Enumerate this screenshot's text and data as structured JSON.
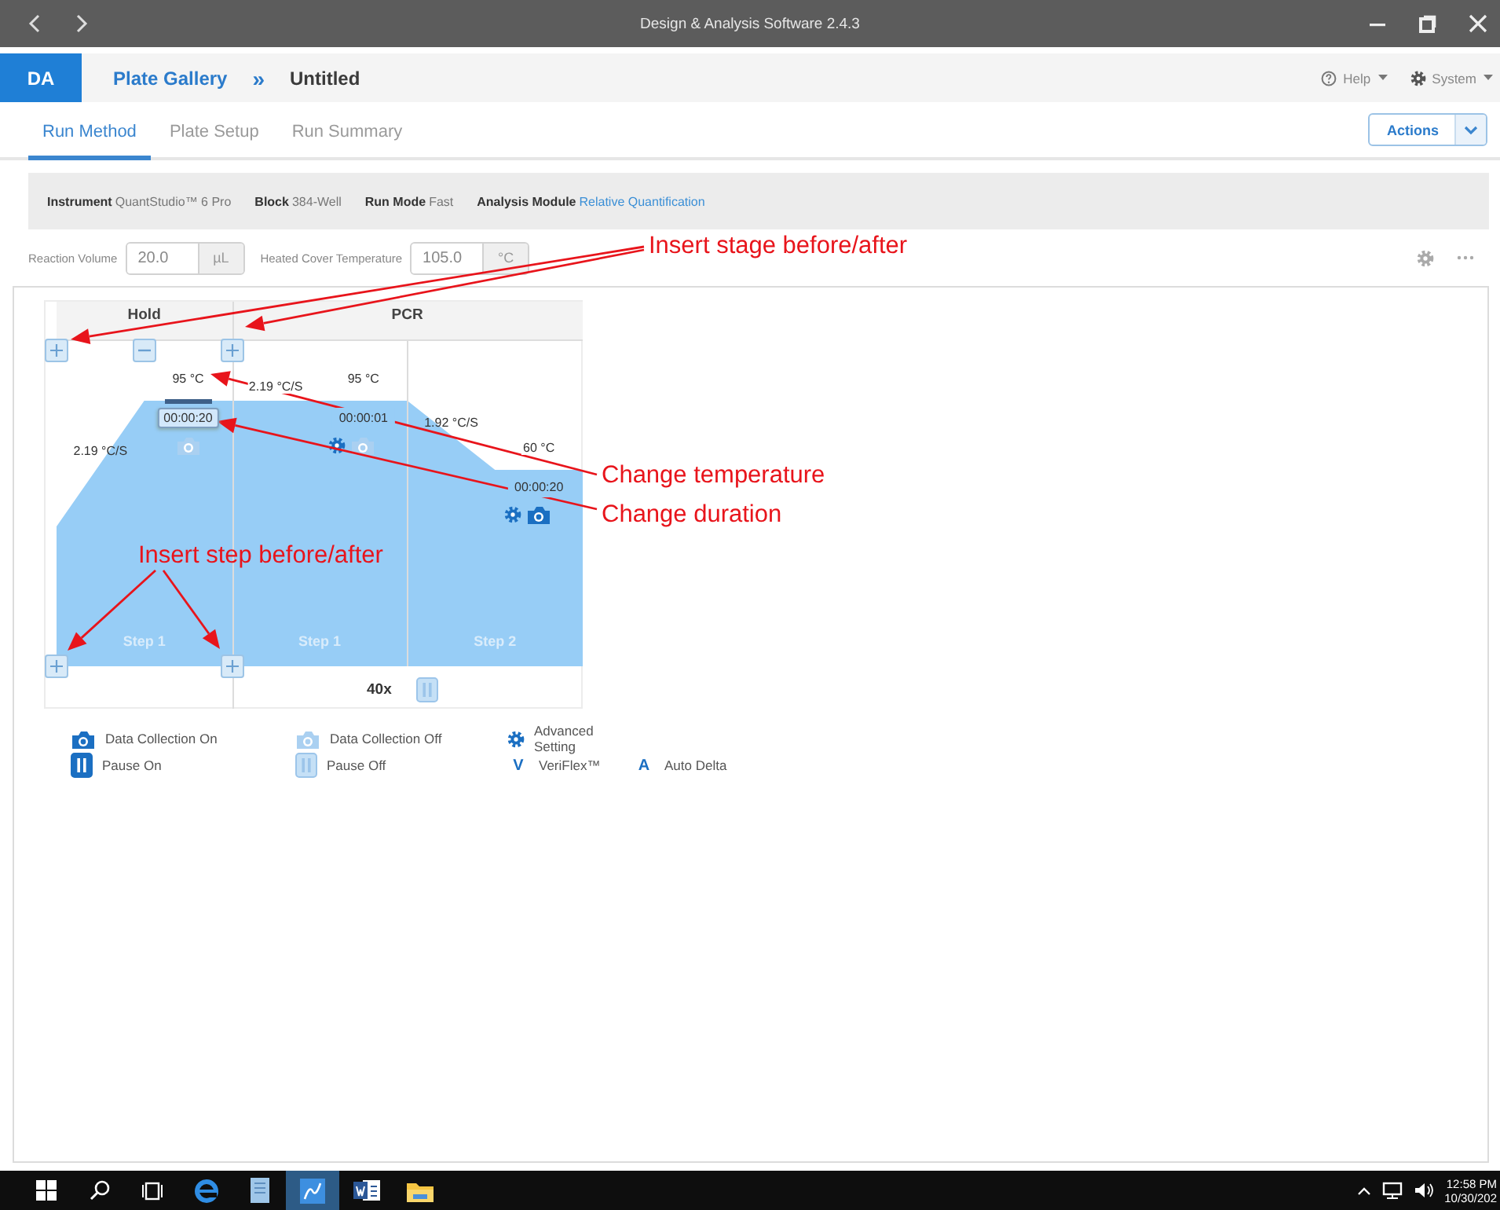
{
  "window": {
    "title": "Design & Analysis Software 2.4.3"
  },
  "header": {
    "logo": "DA",
    "breadcrumb": [
      {
        "label": "Plate Gallery",
        "kind": "link"
      },
      {
        "label": "Untitled",
        "kind": "current"
      }
    ],
    "separator": "»",
    "menus": [
      {
        "label": "Help",
        "kind": "help"
      },
      {
        "label": "System",
        "kind": "system"
      }
    ]
  },
  "tabs": [
    {
      "label": "Run Method",
      "selected": true
    },
    {
      "label": "Plate Setup",
      "selected": false
    },
    {
      "label": "Run Summary",
      "selected": false
    }
  ],
  "actions": {
    "label": "Actions"
  },
  "run_info": [
    {
      "label": "Instrument",
      "value": "QuantStudio™ 6 Pro",
      "kind": "plain"
    },
    {
      "label": "Block",
      "value": "384-Well",
      "kind": "plain"
    },
    {
      "label": "Run Mode",
      "value": "Fast",
      "kind": "plain"
    },
    {
      "label": "Analysis Module",
      "value": "Relative Quantification",
      "kind": "link"
    }
  ],
  "settings": [
    {
      "label": "Reaction Volume",
      "value": "20.0",
      "unit": "µL"
    },
    {
      "label": "Heated Cover Temperature",
      "value": "105.0",
      "unit": "°C"
    }
  ],
  "stages": [
    {
      "name": "Hold",
      "steps": [
        {
          "label": "Step 1",
          "temperature": "95 °C",
          "duration": "00:00:20",
          "ramp": "2.19 °C/S",
          "selected": true,
          "data_collection": false,
          "advanced": false
        }
      ]
    },
    {
      "name": "PCR",
      "cycles": "40x",
      "pause": false,
      "steps": [
        {
          "label": "Step 1",
          "temperature": "95 °C",
          "duration": "00:00:01",
          "ramp": "2.19 °C/S",
          "selected": false,
          "data_collection": false,
          "advanced": true
        },
        {
          "label": "Step 2",
          "temperature": "60 °C",
          "duration": "00:00:20",
          "ramp": "1.92 °C/S",
          "selected": false,
          "data_collection": true,
          "advanced": true
        }
      ]
    }
  ],
  "legend": {
    "rows": [
      {
        "items": [
          {
            "kind": "camera_on",
            "label": "Data Collection On"
          },
          {
            "kind": "camera_off",
            "label": "Data Collection Off"
          },
          {
            "kind": "advanced",
            "label": "Advanced Setting"
          }
        ]
      },
      {
        "items": [
          {
            "kind": "pause_on",
            "label": "Pause On"
          },
          {
            "kind": "pause_off",
            "label": "Pause Off"
          },
          {
            "kind": "letter",
            "symbol": "V",
            "label": "VeriFlex™"
          },
          {
            "kind": "letter",
            "symbol": "A",
            "label": "Auto Delta"
          }
        ]
      }
    ]
  },
  "annotations": [
    {
      "text": "Insert stage before/after"
    },
    {
      "text": "Change temperature"
    },
    {
      "text": "Change duration"
    },
    {
      "text": "Insert step before/after"
    }
  ],
  "taskbar": {
    "time": "12:58 PM",
    "date": "10/30/202"
  }
}
